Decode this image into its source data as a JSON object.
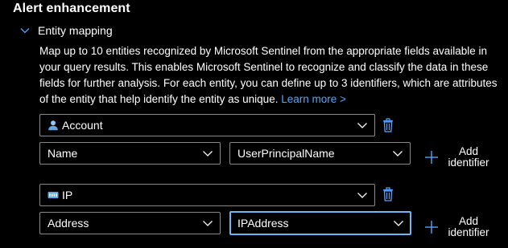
{
  "section": {
    "title": "Alert enhancement"
  },
  "entity_mapping": {
    "label": "Entity mapping",
    "description": "Map up to 10 entities recognized by Microsoft Sentinel from the appropriate fields available in your query results. This enables Microsoft Sentinel to recognize and classify the data in these fields for further analysis. For each entity, you can define up to 3 identifiers, which are attributes of the entity that help identify the entity as unique.",
    "learn_more": "Learn more >"
  },
  "entities": [
    {
      "type": "Account",
      "icon": "account-icon",
      "identifier": "Name",
      "column": "UserPrincipalName",
      "add_label": "Add identifier"
    },
    {
      "type": "IP",
      "icon": "ip-icon",
      "identifier": "Address",
      "column": "IPAddress",
      "add_label": "Add identifier"
    }
  ],
  "colors": {
    "background": "#000000",
    "border": "#8a8886",
    "focus_border": "#6cb8f6",
    "accent": "#4fa6ff"
  }
}
